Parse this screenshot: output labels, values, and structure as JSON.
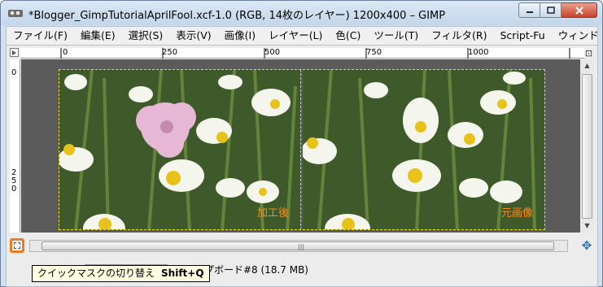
{
  "window": {
    "title": "*Blogger_GimpTutorialAprilFool.xcf-1.0 (RGB, 14枚のレイヤー) 1200x400 – GIMP"
  },
  "menu": [
    "ファイル(F)",
    "編集(E)",
    "選択(S)",
    "表示(V)",
    "画像(I)",
    "レイヤー(L)",
    "色(C)",
    "ツール(T)",
    "フィルタ(R)",
    "Script-Fu",
    "ウィンドウ(W)"
  ],
  "ruler": {
    "h": [
      "0",
      "250",
      "500",
      "750",
      "1000"
    ],
    "v": [
      "0",
      "250"
    ]
  },
  "canvas": {
    "left_caption": "加工後",
    "right_caption": "元画像"
  },
  "status": {
    "text": "プボード#8 (18.7 MB)"
  },
  "tooltip": {
    "label": "クイックマスクの切り替え",
    "shortcut": "Shift+Q"
  },
  "colors": {
    "accent": "#f07a22",
    "caption": "#ff8a1a",
    "selection": "#e8e100"
  },
  "icons": {
    "quick_mask": "quick-mask-icon",
    "navigate": "navigate-move-icon"
  }
}
